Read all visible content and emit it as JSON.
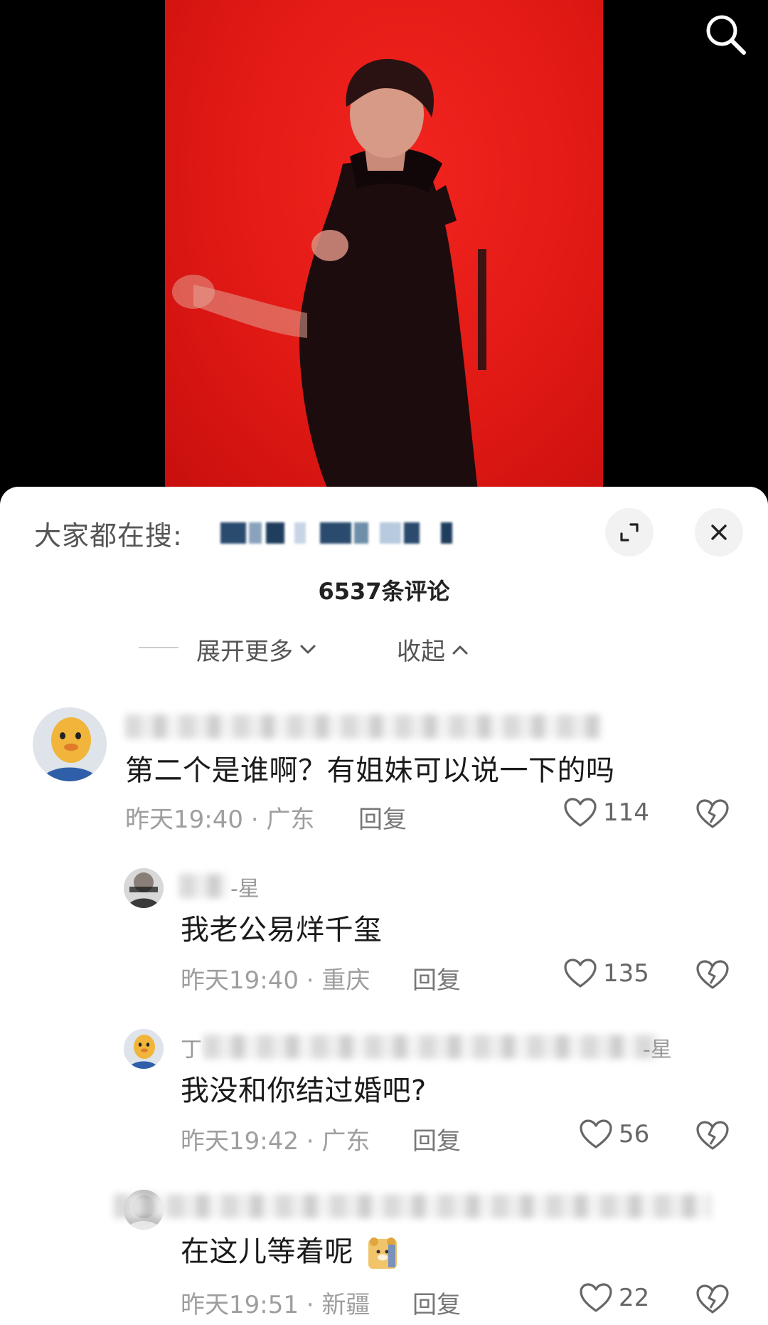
{
  "header": {
    "search_prompt": "大家都在搜:",
    "comment_count": "6537条评论",
    "expand_more": "展开更多",
    "collapse": "收起"
  },
  "comments": [
    {
      "username_suffix": "",
      "text": "第二个是谁啊？有姐妹可以说一下的吗",
      "time": "昨天19:40",
      "location": "广东",
      "reply_label": "回复",
      "likes": "114"
    },
    {
      "username_suffix": "-星",
      "text": "我老公易烊千玺",
      "time": "昨天19:40",
      "location": "重庆",
      "reply_label": "回复",
      "likes": "135"
    },
    {
      "username_prefix": "丁",
      "username_suffix": "-星",
      "text": "我没和你结过婚吧?",
      "time": "昨天19:42",
      "location": "广东",
      "reply_label": "回复",
      "likes": "56"
    },
    {
      "username_suffix": "",
      "text": "在这儿等着呢",
      "time": "昨天19:51",
      "location": "新疆",
      "reply_label": "回复",
      "likes": "22"
    }
  ],
  "colors": {
    "video_bg": "#e11915",
    "sheet_bg": "#ffffff",
    "text_primary": "#1a1a1a",
    "text_secondary": "#9e9e9e"
  },
  "icons": [
    "search-icon",
    "expand-icon",
    "close-icon",
    "chevron-down-icon",
    "chevron-up-icon",
    "heart-icon",
    "broken-heart-icon"
  ]
}
